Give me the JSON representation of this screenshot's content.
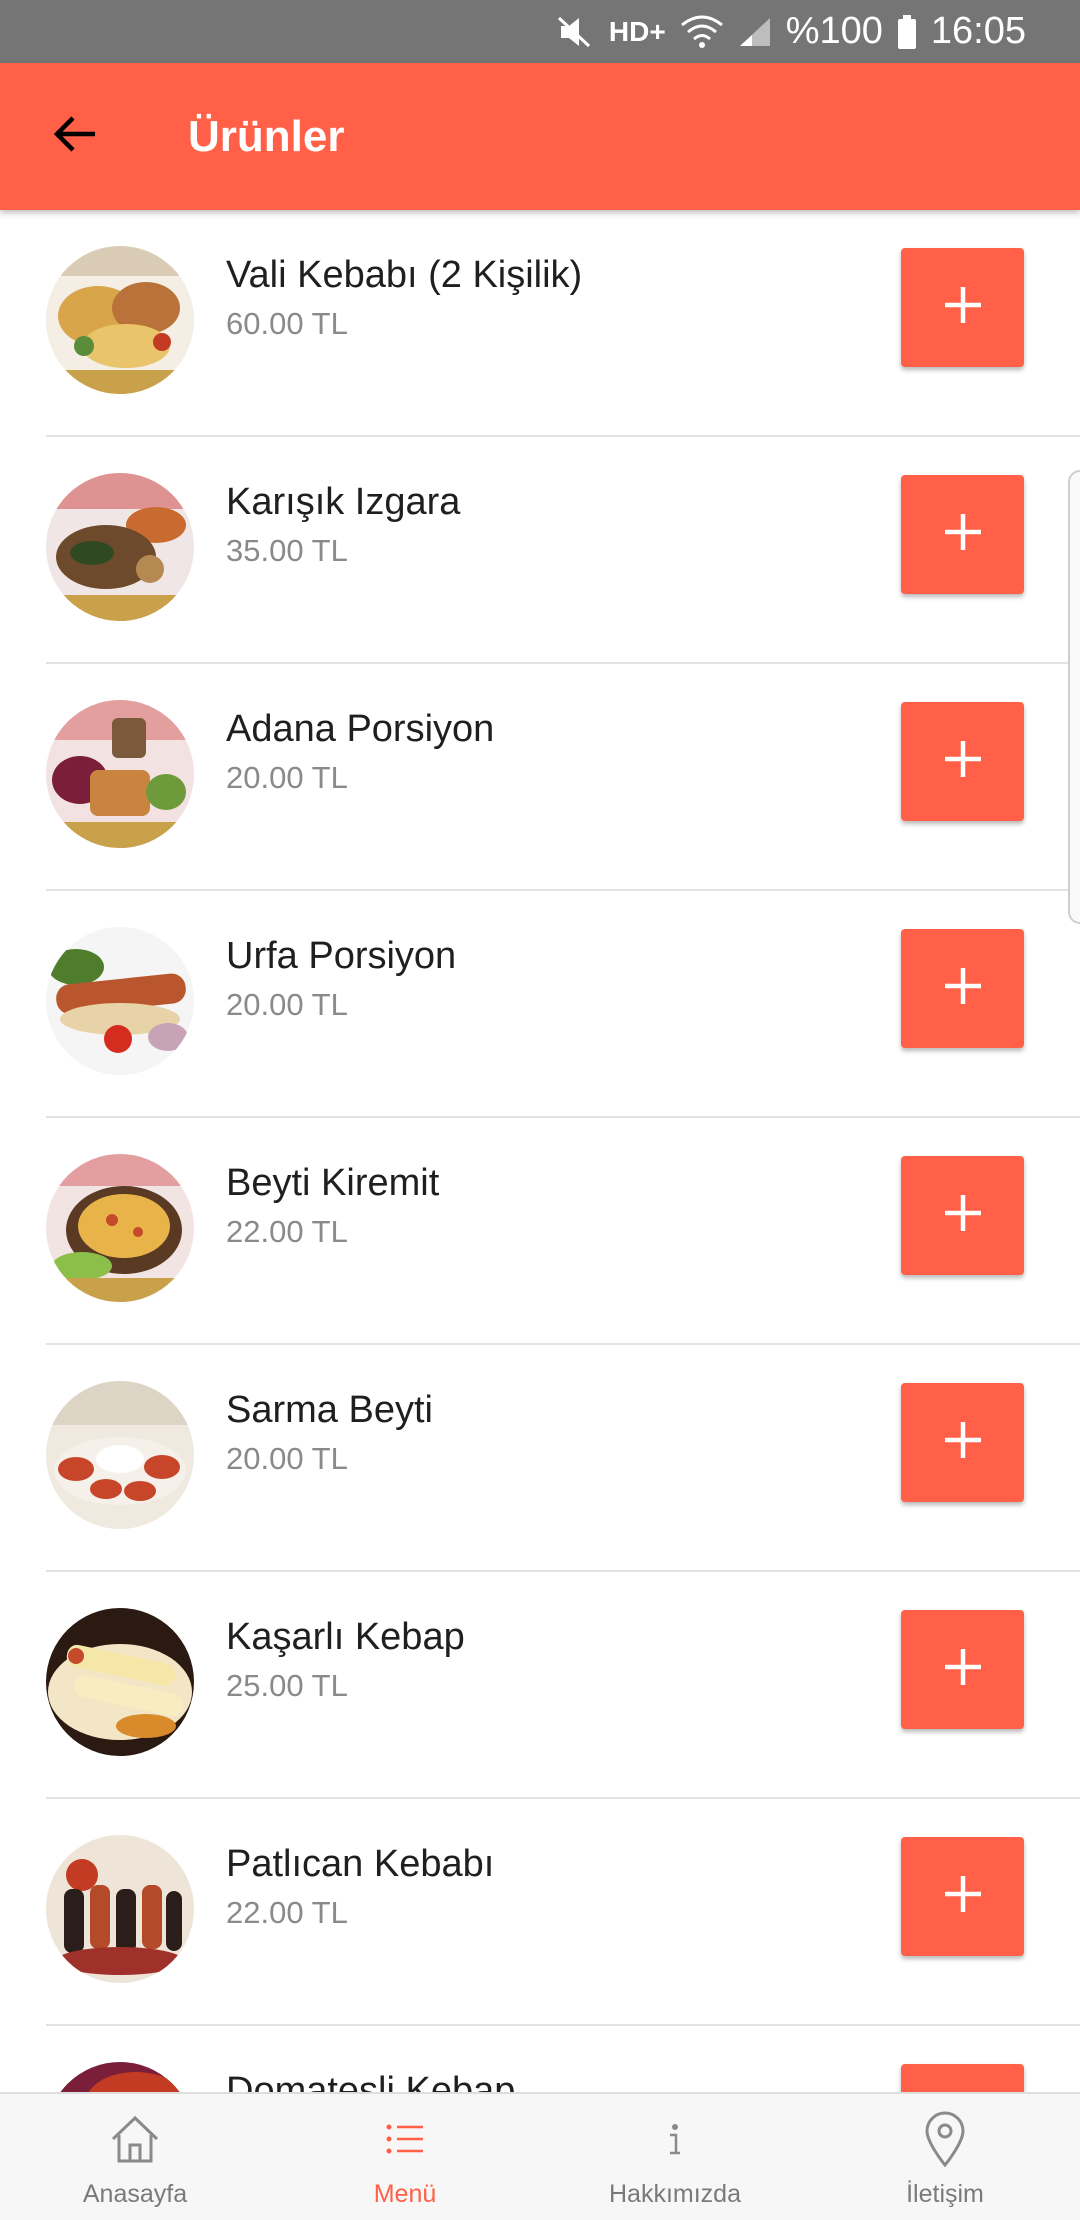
{
  "status_bar": {
    "network": "HD+",
    "battery": "%100",
    "time": "16:05"
  },
  "app_bar": {
    "title": "Ürünler",
    "back_icon": "arrow-back-icon"
  },
  "products": [
    {
      "name": "Vali Kebabı (2 Kişilik)",
      "price": "60.00 TL",
      "add_icon": "plus-icon"
    },
    {
      "name": "Karışık Izgara",
      "price": "35.00 TL",
      "add_icon": "plus-icon"
    },
    {
      "name": "Adana Porsiyon",
      "price": "20.00 TL",
      "add_icon": "plus-icon"
    },
    {
      "name": "Urfa Porsiyon",
      "price": "20.00 TL",
      "add_icon": "plus-icon"
    },
    {
      "name": "Beyti Kiremit",
      "price": "22.00 TL",
      "add_icon": "plus-icon"
    },
    {
      "name": "Sarma Beyti",
      "price": "20.00 TL",
      "add_icon": "plus-icon"
    },
    {
      "name": "Kaşarlı Kebap",
      "price": "25.00 TL",
      "add_icon": "plus-icon"
    },
    {
      "name": "Patlıcan Kebabı",
      "price": "22.00 TL",
      "add_icon": "plus-icon"
    },
    {
      "name": "Domatesli Kebap",
      "price": "",
      "add_icon": "plus-icon"
    }
  ],
  "bottom_nav": [
    {
      "label": "Anasayfa",
      "icon": "home-icon",
      "active": false
    },
    {
      "label": "Menü",
      "icon": "list-icon",
      "active": true
    },
    {
      "label": "Hakkımızda",
      "icon": "info-icon",
      "active": false
    },
    {
      "label": "İletişim",
      "icon": "location-pin-icon",
      "active": false
    }
  ],
  "colors": {
    "accent": "#ff6047",
    "status_bar": "#757575"
  }
}
